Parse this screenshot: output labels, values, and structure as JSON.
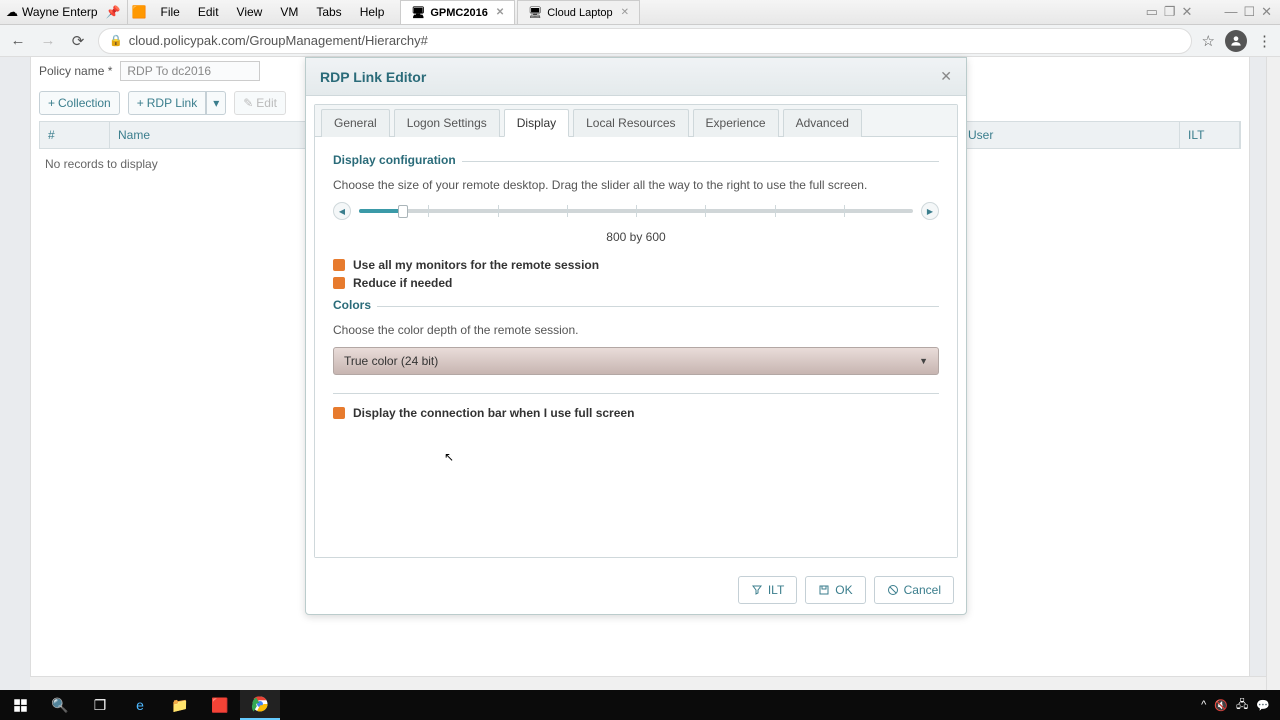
{
  "vm": {
    "host_tab": "Wayne Enterp",
    "menus": [
      "File",
      "Edit",
      "View",
      "VM",
      "Tabs",
      "Help"
    ],
    "tabs": [
      {
        "label": "GPMC2016",
        "active": true
      },
      {
        "label": "Cloud Laptop",
        "active": false
      }
    ]
  },
  "browser": {
    "url": "cloud.policypak.com/GroupManagement/Hierarchy#"
  },
  "page": {
    "policy_name_label": "Policy name *",
    "policy_name_value": "RDP To dc2016",
    "toolbar": {
      "collection": "Collection",
      "rdp_link": "RDP Link",
      "edit": "Edit"
    },
    "grid": {
      "cols": {
        "hash": "#",
        "name": "Name",
        "user": "User",
        "ilt": "ILT"
      },
      "empty": "No records to display"
    }
  },
  "modal": {
    "title": "RDP Link Editor",
    "tabs": [
      "General",
      "Logon Settings",
      "Display",
      "Local Resources",
      "Experience",
      "Advanced"
    ],
    "active_tab": "Display",
    "display": {
      "group1_title": "Display configuration",
      "group1_desc": "Choose the size of your remote desktop. Drag the slider all the way to the right to use the full screen.",
      "slider_value": "800 by 600",
      "chk_allmon": "Use all my monitors for the remote session",
      "chk_reduce": "Reduce if needed",
      "group2_title": "Colors",
      "group2_desc": "Choose the color depth of the remote session.",
      "color_select": "True color (24 bit)",
      "chk_connbar": "Display the connection bar when I use full screen"
    },
    "footer": {
      "ilt": "ILT",
      "ok": "OK",
      "cancel": "Cancel"
    }
  }
}
